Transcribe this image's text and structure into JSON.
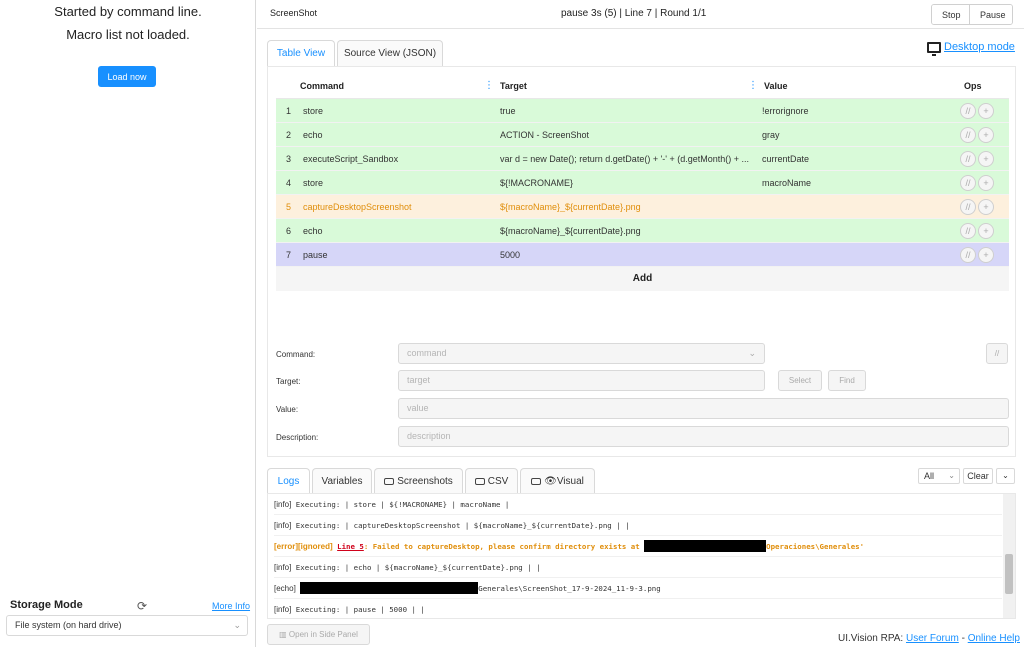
{
  "left": {
    "message1": "Started by command line.",
    "message2": "Macro list not loaded.",
    "load_button": "Load now",
    "storage_label": "Storage Mode",
    "more_info": "More Info",
    "storage_value": "File system (on hard drive)"
  },
  "topbar": {
    "macro_name": "ScreenShot",
    "status": "pause 3s (5) | Line 7 | Round 1/1",
    "stop": "Stop",
    "pause": "Pause"
  },
  "tabs": {
    "table": "Table View",
    "source": "Source View (JSON)"
  },
  "desktop_mode": "Desktop mode",
  "table": {
    "headers": {
      "command": "Command",
      "target": "Target",
      "value": "Value",
      "ops": "Ops"
    },
    "rows": [
      {
        "num": "1",
        "command": "store",
        "target": "true",
        "value": "!errorignore",
        "state": "ok"
      },
      {
        "num": "2",
        "command": "echo",
        "target": "ACTION - ScreenShot",
        "value": "gray",
        "state": "ok"
      },
      {
        "num": "3",
        "command": "executeScript_Sandbox",
        "target": "var d = new Date(); return d.getDate() + '-' + (d.getMonth() + ...",
        "value": "currentDate",
        "state": "ok"
      },
      {
        "num": "4",
        "command": "store",
        "target": "${!MACRONAME}",
        "value": "macroName",
        "state": "ok"
      },
      {
        "num": "5",
        "command": "captureDesktopScreenshot",
        "target": "${macroName}_${currentDate}.png",
        "value": "",
        "state": "err"
      },
      {
        "num": "6",
        "command": "echo",
        "target": "${macroName}_${currentDate}.png",
        "value": "",
        "state": "ok"
      },
      {
        "num": "7",
        "command": "pause",
        "target": "5000",
        "value": "",
        "state": "cur"
      }
    ],
    "add": "Add"
  },
  "form": {
    "command_label": "Command:",
    "command_placeholder": "command",
    "target_label": "Target:",
    "target_placeholder": "target",
    "select": "Select",
    "find": "Find",
    "value_label": "Value:",
    "value_placeholder": "value",
    "description_label": "Description:",
    "description_placeholder": "description",
    "comment_button": "//"
  },
  "log_tabs": {
    "logs": "Logs",
    "variables": "Variables",
    "screenshots": "Screenshots",
    "csv": "CSV",
    "visual": "Visual"
  },
  "log_controls": {
    "filter": "All",
    "clear": "Clear"
  },
  "logs": {
    "l1_tag": "[info]",
    "l1_text": "Executing:  | store | ${!MACRONAME} | macroName |",
    "l2_tag": "[info]",
    "l2_text": "Executing:  | captureDesktopScreenshot | ${macroName}_${currentDate}.png |  |",
    "l3_tag": "[error][ignored]",
    "l3_line": "Line 5",
    "l3_text": ": Failed to captureDesktop, please confirm directory exists at",
    "l3_tail": "Operaciones\\Generales'",
    "l4_tag": "[info]",
    "l4_text": "Executing:  | echo | ${macroName}_${currentDate}.png |  |",
    "l5_tag": "[echo]",
    "l5_text": "Generales\\ScreenShot_17-9-2024_11-9-3.png",
    "l6_tag": "[info]",
    "l6_text": "Executing:  | pause | 5000 |  |"
  },
  "footer": {
    "side_panel": "Open in Side Panel",
    "brand": "UI.Vision RPA:",
    "forum": "User Forum",
    "sep": "-",
    "help": "Online Help"
  },
  "colors": {
    "accent": "#1890ff",
    "ok_row": "#d9fad9",
    "error_row": "#fdf0dd",
    "current_row": "#d6d6f8",
    "error_text": "#e08e0b"
  }
}
